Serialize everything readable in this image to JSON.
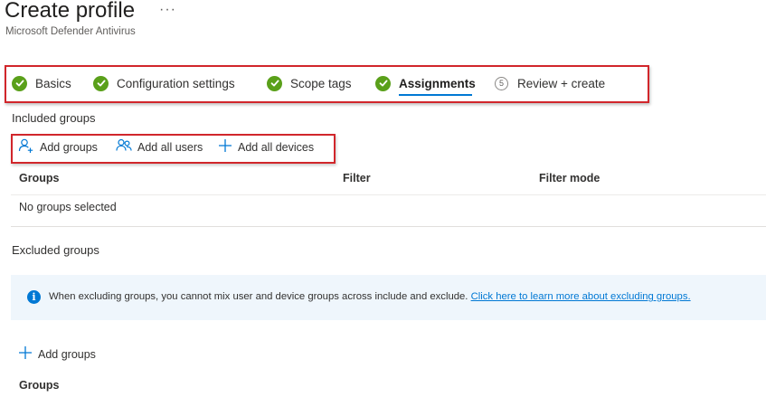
{
  "header": {
    "title": "Create profile",
    "more_label": "···",
    "subtitle": "Microsoft Defender Antivirus"
  },
  "wizard": {
    "steps": [
      {
        "label": "Basics",
        "state": "complete"
      },
      {
        "label": "Configuration settings",
        "state": "complete"
      },
      {
        "label": "Scope tags",
        "state": "complete"
      },
      {
        "label": "Assignments",
        "state": "current"
      },
      {
        "label": "Review + create",
        "state": "pending",
        "number": "5"
      }
    ]
  },
  "included": {
    "heading": "Included groups",
    "commands": {
      "add_groups": "Add groups",
      "add_all_users": "Add all users",
      "add_all_devices": "Add all devices"
    },
    "table": {
      "columns": [
        "Groups",
        "Filter",
        "Filter mode"
      ],
      "empty_text": "No groups selected"
    }
  },
  "excluded": {
    "heading": "Excluded groups",
    "info": {
      "text": "When excluding groups, you cannot mix user and device groups across include and exclude.",
      "link": "Click here to learn more about excluding groups."
    },
    "add_groups": "Add groups",
    "table": {
      "columns": [
        "Groups"
      ]
    }
  },
  "colors": {
    "accent": "#0078d4",
    "success": "#5aa01a",
    "highlight_border": "#d1262b",
    "info_background": "#eff6fc"
  }
}
